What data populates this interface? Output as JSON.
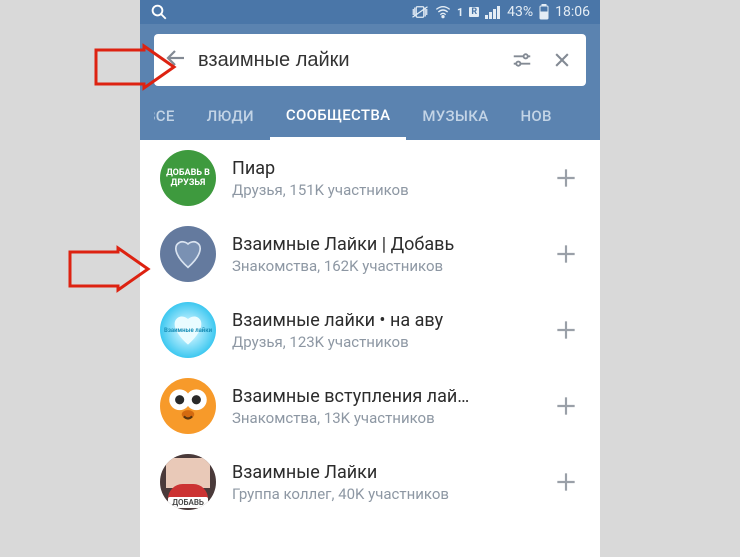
{
  "statusbar": {
    "battery": "43%",
    "time": "18:06"
  },
  "search": {
    "value": "взаимные лайки"
  },
  "tabs": [
    {
      "label": "ВСЕ",
      "active": false,
      "cut": "left"
    },
    {
      "label": "ЛЮДИ",
      "active": false
    },
    {
      "label": "СООБЩЕСТВА",
      "active": true
    },
    {
      "label": "МУЗЫКА",
      "active": false
    },
    {
      "label": "НОВ",
      "active": false,
      "cut": "right"
    }
  ],
  "results": [
    {
      "title": "Пиар",
      "sub": "Друзья, 151K участников",
      "avatar_text": "ДОБАВЬ В ДРУЗЬЯ"
    },
    {
      "title": "Взаимные Лайки | Добавь",
      "sub": "Знакомства, 162K участников"
    },
    {
      "title": "Взаимные лайки • на аву",
      "sub": "Друзья, 123K участников",
      "avatar_small": "Взаимные лайки"
    },
    {
      "title": "Взаимные вступления лай…",
      "sub": "Знакомства, 13K участников"
    },
    {
      "title": "Взаимные Лайки",
      "sub": "Группа коллег, 40K участников",
      "avatar_tag": "ДОБАВЬ"
    }
  ]
}
